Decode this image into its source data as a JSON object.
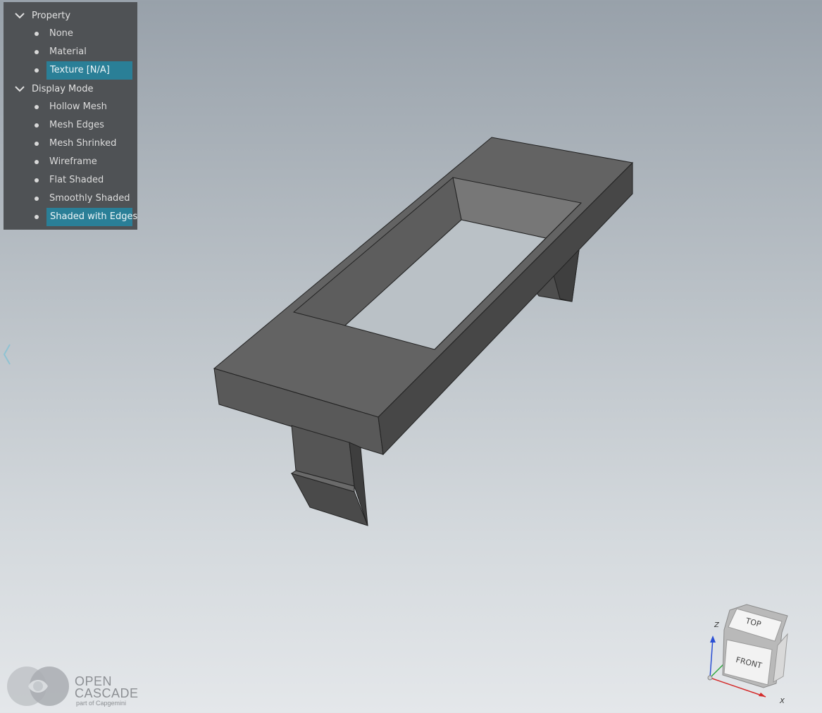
{
  "panel": {
    "groups": [
      {
        "label": "Property",
        "items": [
          {
            "label": "None",
            "selected": false
          },
          {
            "label": "Material",
            "selected": false
          },
          {
            "label": "Texture [N/A]",
            "selected": true
          }
        ]
      },
      {
        "label": "Display Mode",
        "items": [
          {
            "label": "Hollow Mesh",
            "selected": false
          },
          {
            "label": "Mesh Edges",
            "selected": false
          },
          {
            "label": "Mesh Shrinked",
            "selected": false
          },
          {
            "label": "Wireframe",
            "selected": false
          },
          {
            "label": "Flat Shaded",
            "selected": false
          },
          {
            "label": "Smoothly Shaded",
            "selected": false
          },
          {
            "label": "Shaded with Edges",
            "selected": true
          }
        ]
      }
    ]
  },
  "side_toggle": {
    "icon": "chevron-left-icon"
  },
  "logo": {
    "line1": "OPEN",
    "line2": "CASCADE",
    "tagline": "part of Capgemini"
  },
  "viewcube": {
    "top_label": "TOP",
    "front_label": "FRONT",
    "axis_z": "Z",
    "axis_x": "X"
  },
  "colors": {
    "selection": "#2a7f97",
    "panel_bg": "#4f5255",
    "model_top": "#646464",
    "model_side": "#4a4a4a"
  }
}
